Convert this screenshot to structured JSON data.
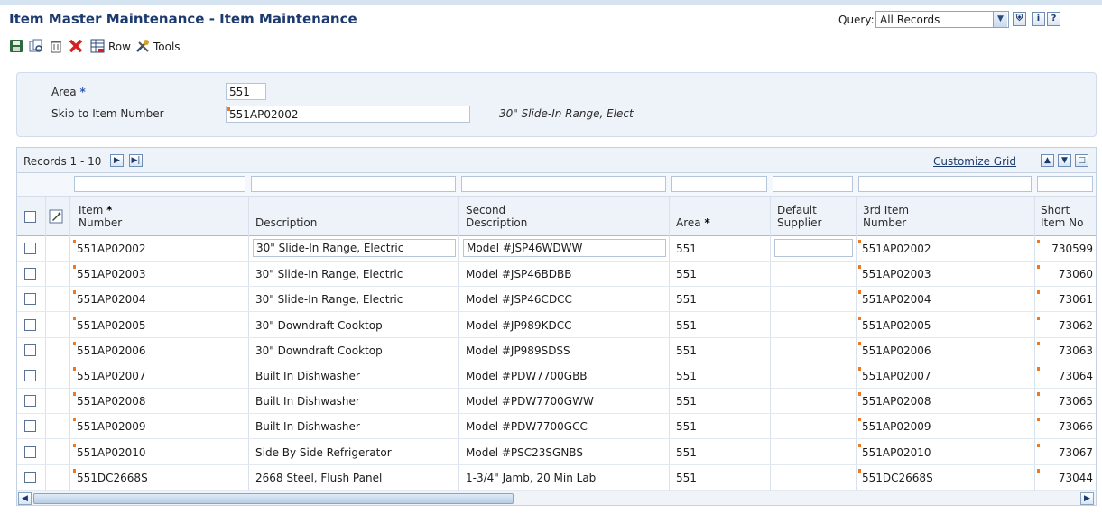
{
  "window": {
    "title": "Item Master Maintenance - Item Maintenance"
  },
  "query": {
    "label": "Query:",
    "value": "All Records"
  },
  "toolbar": {
    "row_label": "Row",
    "tools_label": "Tools"
  },
  "header": {
    "area_label": "Area",
    "area_value": "551",
    "skip_label": "Skip to Item Number",
    "skip_value": "551AP02002",
    "skip_description": "30\" Slide-In Range, Elect"
  },
  "grid": {
    "records_label": "Records 1 - 10",
    "customize_label": "Customize Grid",
    "columns": {
      "item_number": [
        "Item",
        "Number"
      ],
      "description": "Description",
      "second_description": [
        "Second",
        "Description"
      ],
      "area": "Area",
      "default_supplier": [
        "Default",
        "Supplier"
      ],
      "third_item_number": [
        "3rd Item",
        "Number"
      ],
      "short_item_no": [
        "Short",
        "Item No"
      ]
    },
    "rows": [
      {
        "item": "551AP02002",
        "desc": "30\" Slide-In Range, Electric",
        "desc2": "Model #JSP46WDWW",
        "area": "551",
        "third": "551AP02002",
        "short": "730599"
      },
      {
        "item": "551AP02003",
        "desc": "30\" Slide-In Range, Electric",
        "desc2": "Model #JSP46BDBB",
        "area": "551",
        "third": "551AP02003",
        "short": "73060"
      },
      {
        "item": "551AP02004",
        "desc": "30\" Slide-In Range, Electric",
        "desc2": "Model #JSP46CDCC",
        "area": "551",
        "third": "551AP02004",
        "short": "73061"
      },
      {
        "item": "551AP02005",
        "desc": "30\" Downdraft Cooktop",
        "desc2": "Model #JP989KDCC",
        "area": "551",
        "third": "551AP02005",
        "short": "73062"
      },
      {
        "item": "551AP02006",
        "desc": "30\" Downdraft Cooktop",
        "desc2": "Model #JP989SDSS",
        "area": "551",
        "third": "551AP02006",
        "short": "73063"
      },
      {
        "item": "551AP02007",
        "desc": "Built In Dishwasher",
        "desc2": "Model #PDW7700GBB",
        "area": "551",
        "third": "551AP02007",
        "short": "73064"
      },
      {
        "item": "551AP02008",
        "desc": "Built In Dishwasher",
        "desc2": "Model #PDW7700GWW",
        "area": "551",
        "third": "551AP02008",
        "short": "73065"
      },
      {
        "item": "551AP02009",
        "desc": "Built In Dishwasher",
        "desc2": "Model #PDW7700GCC",
        "area": "551",
        "third": "551AP02009",
        "short": "73066"
      },
      {
        "item": "551AP02010",
        "desc": "Side By Side Refrigerator",
        "desc2": "Model #PSC23SGNBS",
        "area": "551",
        "third": "551AP02010",
        "short": "73067"
      },
      {
        "item": "551DC2668S",
        "desc": "2668 Steel, Flush Panel",
        "desc2": "1-3/4\" Jamb, 20 Min Lab",
        "area": "551",
        "third": "551DC2668S",
        "short": "73044"
      }
    ]
  },
  "colors": {
    "title": "#1c3a6e",
    "panel": "#eef3f9",
    "accent_flag": "#f07820"
  },
  "icons": [
    "save-icon",
    "copy-icon",
    "delete-icon",
    "cancel-icon",
    "row-icon",
    "tools-icon",
    "filter-icon",
    "info-icon",
    "help-icon",
    "next-icon",
    "last-icon",
    "export-icon",
    "import-icon",
    "maximize-icon",
    "attachment-icon"
  ]
}
